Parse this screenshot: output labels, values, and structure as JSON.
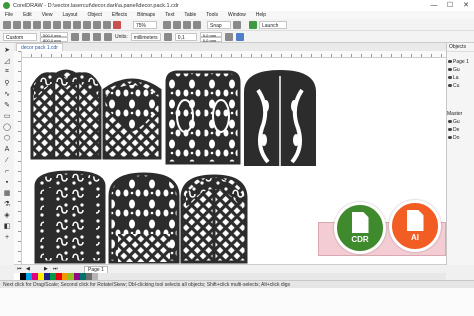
{
  "window": {
    "title": "CorelDRAW - D:\\vector.lasercut\\decor.dark\\a.panel\\decor.pack.1.cdr",
    "controls": [
      "—",
      "☐",
      "✕"
    ]
  },
  "menu": [
    "File",
    "Edit",
    "View",
    "Layout",
    "Object",
    "Effects",
    "Bitmaps",
    "Text",
    "Table",
    "Tools",
    "Window",
    "Help"
  ],
  "toolbar": {
    "zoom_value": "75%",
    "snap_to_label": "Snap To",
    "launch_label": "Launch"
  },
  "property_bar": {
    "page_preset": "Custom",
    "width_value": "500,0 mm",
    "height_value": "800,0 mm",
    "units_label": "Units:",
    "units_value": "millimeters",
    "nudge_value": "0,1 mm",
    "dup_x": "5,0 mm",
    "dup_y": "5,0 mm"
  },
  "doc_tab": {
    "label": "decor pack 1.cdr"
  },
  "docker": {
    "header": "Objects",
    "rows": [
      {
        "label": "Page 1"
      },
      {
        "label": "Gu"
      },
      {
        "label": "La"
      },
      {
        "label": "Cu"
      },
      {
        "label": "Master"
      },
      {
        "label": "Gu"
      },
      {
        "label": "De"
      },
      {
        "label": "Do"
      }
    ]
  },
  "page_nav": {
    "page_label": "Page 1"
  },
  "status": {
    "text": "Next click for Drag/Scale; Second click for Rotate/Skew; Dbl-clicking tool selects all objects; Shift+click multi-selects; Alt+click digs"
  },
  "palette": [
    "#ffffff",
    "#000000",
    "#00a0e9",
    "#e4007f",
    "#fff100",
    "#1d2088",
    "#009944",
    "#e60012",
    "#f39800",
    "#8fc31f",
    "#920783",
    "#00736d",
    "#6e6e6e",
    "#b5b5b5"
  ],
  "badges": [
    {
      "label": "CDR",
      "color": "#3f8a2c"
    },
    {
      "label": "AI",
      "color": "#f25d23"
    }
  ],
  "colors": {
    "artwork": "#2c2c2c",
    "accent_blue": "#2a5ca8"
  }
}
